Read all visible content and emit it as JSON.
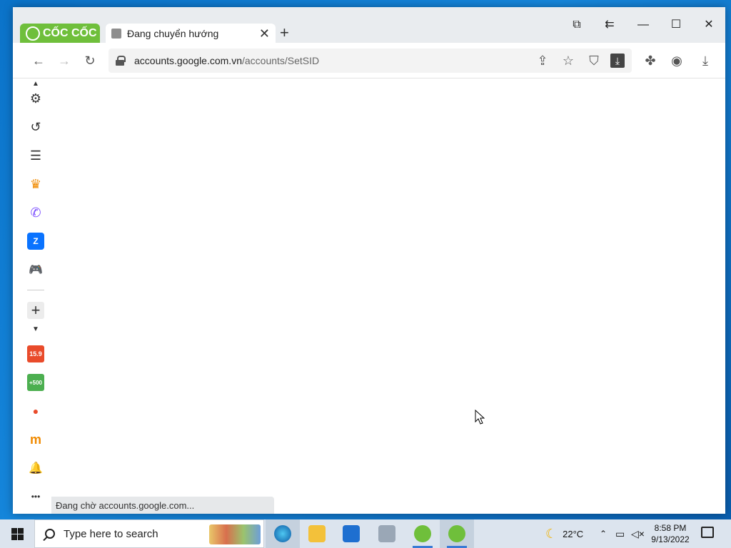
{
  "window": {
    "brand": "CỐC CỐC",
    "tab_title": "Đang chuyển hướng",
    "tab_close": "✕",
    "new_tab": "+",
    "controls": {
      "screen": "⧉",
      "back_arrow": "⇇",
      "minimize": "—",
      "maximize": "☐",
      "close": "✕"
    }
  },
  "toolbar": {
    "back": "←",
    "forward": "→",
    "reload": "↻",
    "url_host": "accounts.google.com.vn",
    "url_path": "/accounts/SetSID",
    "share": "⇪",
    "star": "☆",
    "shield": "⛉",
    "download_box": "⤓",
    "extensions": "✤",
    "profile": "◉",
    "downloads": "⤓"
  },
  "sidebar": {
    "items": [
      {
        "name": "settings",
        "glyph": "⚙"
      },
      {
        "name": "history",
        "glyph": "↺"
      },
      {
        "name": "reading-list",
        "glyph": "☰"
      },
      {
        "name": "crown",
        "glyph": "♛"
      },
      {
        "name": "messenger",
        "glyph": "✆"
      },
      {
        "name": "zalo",
        "glyph": "Z"
      },
      {
        "name": "games",
        "glyph": "🎮"
      },
      {
        "name": "add",
        "glyph": "+"
      },
      {
        "name": "sale-15-9",
        "glyph": "15.9"
      },
      {
        "name": "plus-500",
        "glyph": "+500"
      },
      {
        "name": "coccoc-game",
        "glyph": "●"
      },
      {
        "name": "shopping",
        "glyph": "m"
      },
      {
        "name": "notifications",
        "glyph": "🔔"
      },
      {
        "name": "more",
        "glyph": "•••"
      }
    ]
  },
  "status_bar": "Đang chờ accounts.google.com...",
  "taskbar": {
    "search_placeholder": "Type here to search",
    "weather": "22°C",
    "time": "8:58 PM",
    "date": "9/13/2022"
  },
  "colors": {
    "brand_green": "#6fbf3b",
    "titlebar": "#e9ecef",
    "taskbar": "#dce4ee",
    "desktop": "#0b73c9"
  }
}
